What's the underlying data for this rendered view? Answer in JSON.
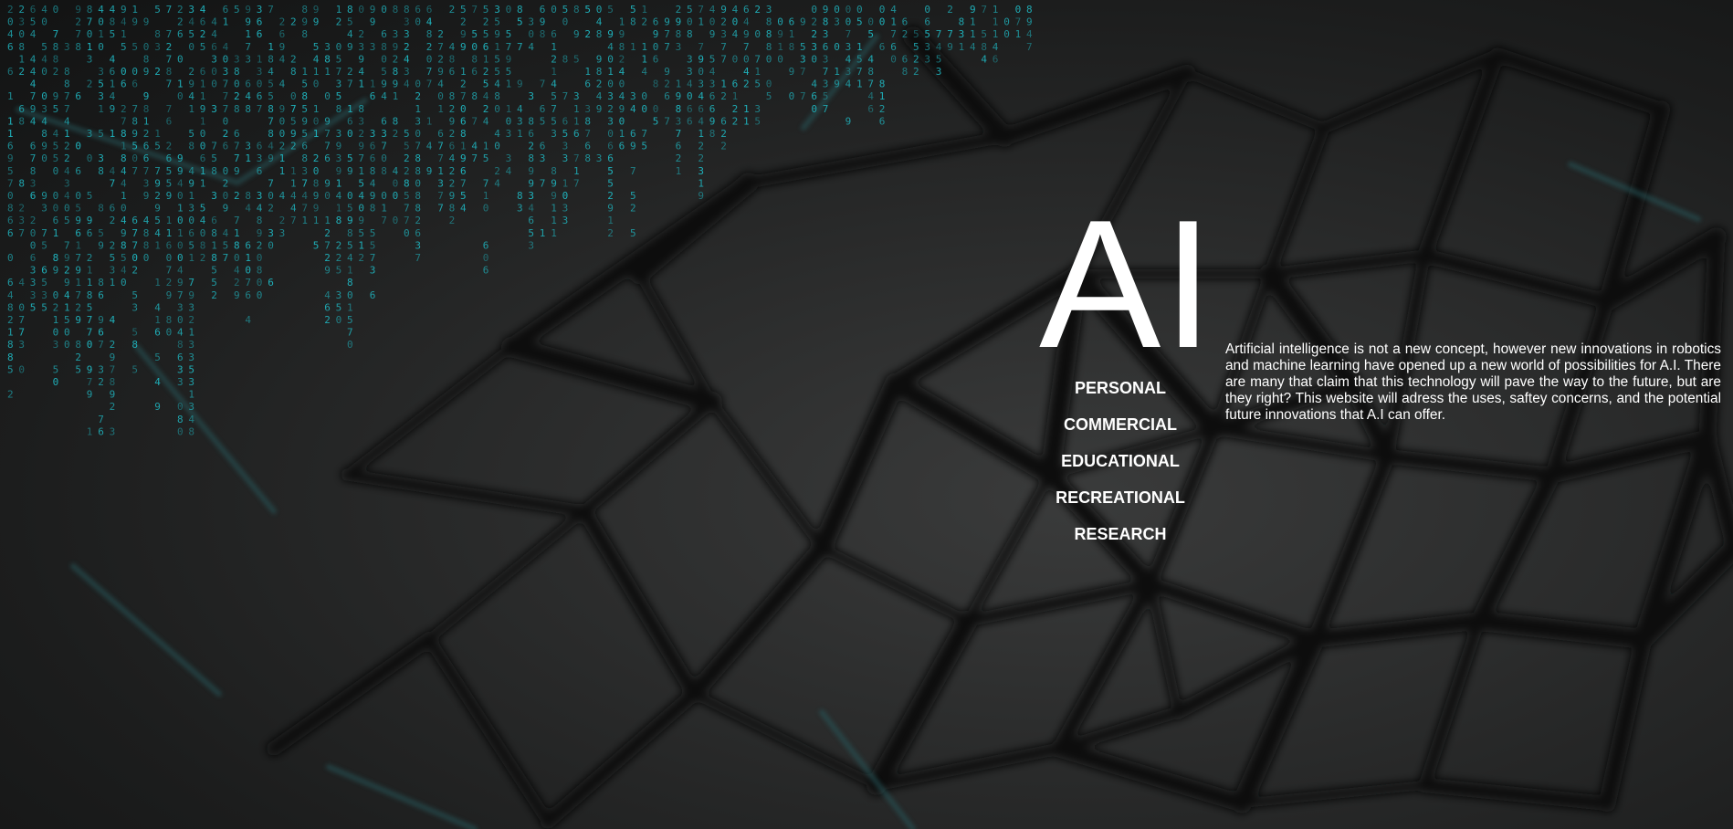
{
  "hero": {
    "title": "AI"
  },
  "nav": {
    "items": [
      {
        "label": "PERSONAL"
      },
      {
        "label": "COMMERCIAL"
      },
      {
        "label": "EDUCATIONAL"
      },
      {
        "label": "RECREATIONAL"
      },
      {
        "label": "RESEARCH"
      }
    ]
  },
  "intro": {
    "text": "Artificial intelligence is not a new concept, however new innovations in robotics and machine learning have opened up a new world of possibilities for A.I. There are many that claim that this technology will pave the way to the future, but are they right? This website will adress the uses, saftey concerns, and the potential future innovations that A.I can offer."
  },
  "colors": {
    "text": "#ffffff",
    "background": "#2b2c2c",
    "mesh": "#0c0e0e",
    "matrix_digits": "#1fb3bd"
  },
  "background": {
    "description_icon": "neural-network-mesh-background-image"
  }
}
